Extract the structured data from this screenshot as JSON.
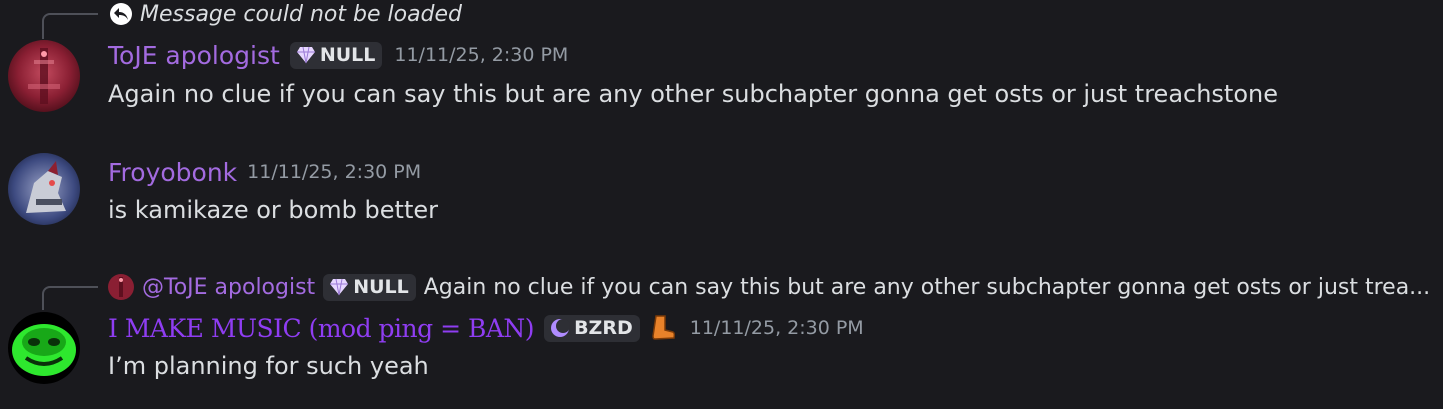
{
  "colors": {
    "background": "#1a1a1e",
    "username_purple": "#a36be0",
    "username_music": "#8f3df2",
    "timestamp": "#949ba4",
    "text": "#dbdee1"
  },
  "messages": [
    {
      "reply": {
        "icon": "reply-arrow-icon",
        "text": "Message could not be loaded"
      },
      "avatar": "red-tower-avatar",
      "username": "ToJE apologist",
      "tag": {
        "icon": "gem-icon",
        "label": "NULL"
      },
      "timestamp": "11/11/25, 2:30 PM",
      "content": "Again no clue if you can say this but are any other subchapter gonna get osts or just treachstone"
    },
    {
      "avatar": "robot-avatar",
      "username": "Froyobonk",
      "timestamp": "11/11/25, 2:30 PM",
      "content": "is kamikaze or bomb better"
    },
    {
      "reply": {
        "avatar": "red-tower-avatar",
        "username": "@ToJE apologist",
        "tag": {
          "icon": "gem-icon",
          "label": "NULL"
        },
        "text": "Again no clue if you can say this but are any other subchapter gonna get osts or just trea..."
      },
      "avatar": "green-creature-avatar",
      "username": "I MAKE MUSIC (mod ping = BAN)",
      "tag": {
        "icon": "moon-icon",
        "label": "BZRD"
      },
      "badge_icon": "boot-icon",
      "timestamp": "11/11/25, 2:30 PM",
      "content": "I’m planning for such yeah"
    }
  ]
}
